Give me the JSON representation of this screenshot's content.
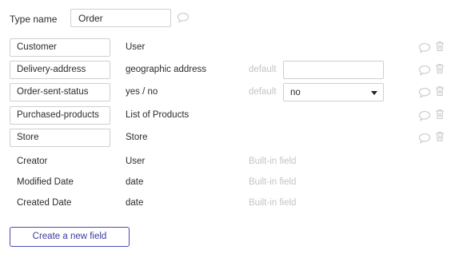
{
  "header": {
    "type_name_label": "Type name",
    "type_name_value": "Order"
  },
  "fields": [
    {
      "name": "Customer",
      "type": "User",
      "default_label": "",
      "default_value": "",
      "builtin": ""
    },
    {
      "name": "Delivery-address",
      "type": "geographic address",
      "default_label": "default",
      "default_value": "",
      "builtin": ""
    },
    {
      "name": "Order-sent-status",
      "type": "yes / no",
      "default_label": "default",
      "default_value": "no",
      "builtin": ""
    },
    {
      "name": "Purchased-products",
      "type": "List of Products",
      "default_label": "",
      "default_value": "",
      "builtin": ""
    },
    {
      "name": "Store",
      "type": "Store",
      "default_label": "",
      "default_value": "",
      "builtin": ""
    },
    {
      "name": "Creator",
      "type": "User",
      "default_label": "",
      "default_value": "",
      "builtin": "Built-in field"
    },
    {
      "name": "Modified Date",
      "type": "date",
      "default_label": "",
      "default_value": "",
      "builtin": "Built-in field"
    },
    {
      "name": "Created Date",
      "type": "date",
      "default_label": "",
      "default_value": "",
      "builtin": "Built-in field"
    }
  ],
  "actions": {
    "create_field_label": "Create a new field"
  },
  "icons": {
    "comment": "speech-bubble-icon",
    "delete": "trash-icon",
    "dropdown": "caret-down-icon"
  },
  "colors": {
    "border": "#cfcfcf",
    "muted_text": "#c4c4c4",
    "icon": "#c8c8c8",
    "accent": "#4a4ab8"
  }
}
